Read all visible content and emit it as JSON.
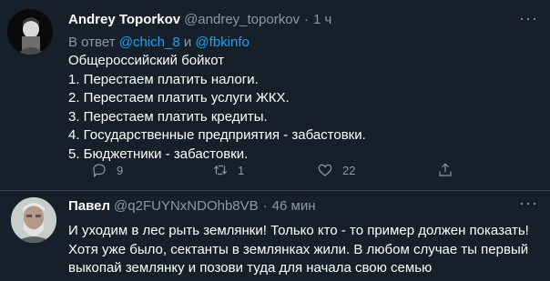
{
  "tweet1": {
    "author_name": "Andrey Toporkov",
    "handle": "@andrey_toporkov",
    "separator": "·",
    "time": "1 ч",
    "reply_prefix": "В ответ",
    "reply_user1": "@chich_8",
    "reply_joiner": "и",
    "reply_user2": "@fbkinfo",
    "lines": [
      "Общероссийский бойкот",
      "1. Перестаем платить налоги.",
      "2. Перестаем платить услуги ЖКХ.",
      "3. Перестаем платить кредиты.",
      "4. Государственные предприятия - забастовки.",
      "5. Бюджетники - забастовки."
    ],
    "reply_count": "9",
    "retweet_count": "1",
    "like_count": "22",
    "more_label": "···"
  },
  "tweet2": {
    "author_name": "Павел",
    "handle": "@q2FUYNxNDOhb8VB",
    "separator": "·",
    "time": "46 мин",
    "lines": [
      "И уходим в лес рыть землянки! Только кто - то пример должен показать!",
      "Хотя уже было, сектанты в землянках жили. В любом случае ты первый",
      "выкопай землянку и позови туда для начала свою семью"
    ],
    "more_label": "···"
  },
  "icons": [
    "reply-icon",
    "retweet-icon",
    "like-icon",
    "share-icon",
    "more-icon"
  ],
  "colors": {
    "background": "#15202b",
    "link": "#1da1f2",
    "muted": "#8899a6",
    "divider": "#38444d"
  }
}
